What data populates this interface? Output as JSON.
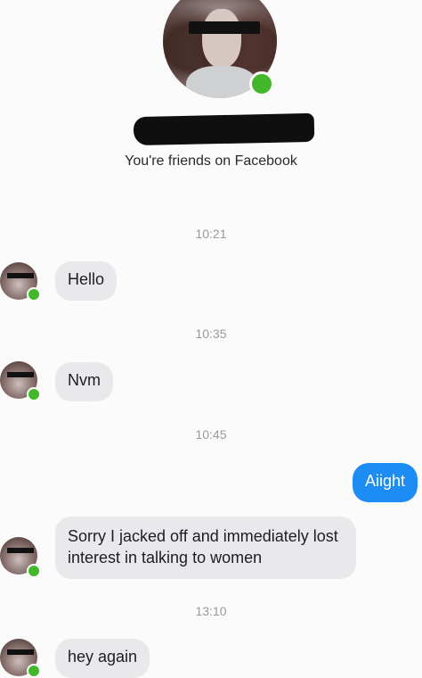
{
  "header": {
    "friends_text": "You're friends on Facebook"
  },
  "messages": [
    {
      "time": "10:21",
      "text": "Hello",
      "from": "them"
    },
    {
      "time": "10:35",
      "text": "Nvm",
      "from": "them"
    },
    {
      "time": "10:45",
      "text": "Aiight",
      "from": "me"
    },
    {
      "time": "",
      "text": "Sorry I jacked off and immediately lost interest in talking to women",
      "from": "them"
    },
    {
      "time": "13:10",
      "text": "hey again",
      "from": "them"
    }
  ],
  "colors": {
    "sent_bubble": "#1d8cf5",
    "received_bubble": "#e9e9eb",
    "online": "#42b72a",
    "timestamp": "#9a9a9a"
  },
  "icons": {
    "online_indicator": "online-dot-icon"
  }
}
